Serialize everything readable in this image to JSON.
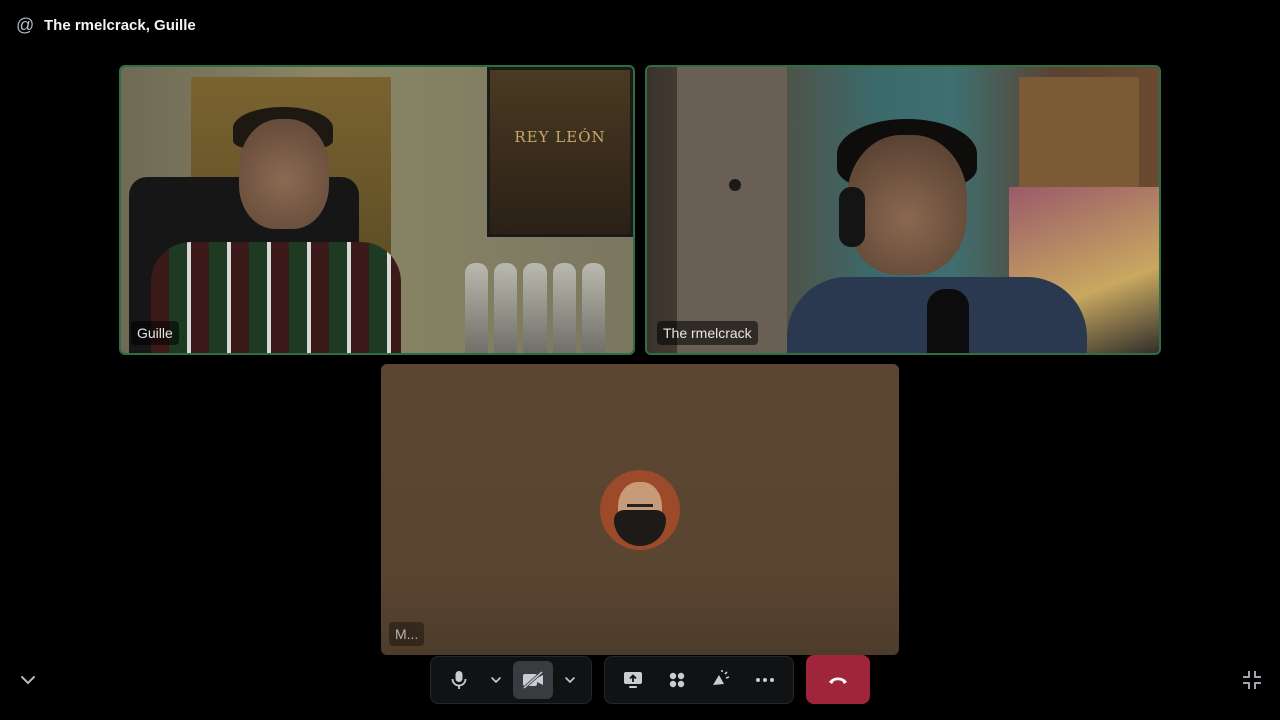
{
  "header": {
    "icon": "at-icon",
    "at_symbol": "@",
    "title": "The rmelcrack, Guille"
  },
  "participants": [
    {
      "name": "Guille",
      "type": "video",
      "speaking": true
    },
    {
      "name": "The rmelcrack",
      "type": "video",
      "speaking": true
    },
    {
      "name": "M...",
      "type": "avatar",
      "speaking": false
    }
  ],
  "video_guille": {
    "poster_text": "REY LEÓN"
  },
  "controls": {
    "mic_icon": "microphone-icon",
    "camera_icon": "camera-off-icon",
    "screen_share_icon": "screen-share-icon",
    "activities_icon": "activities-icon",
    "soundboard_icon": "soundboard-icon",
    "more_icon": "more-icon",
    "hangup_icon": "phone-hangup-icon"
  },
  "colors": {
    "speaking_border": "#2f6e42",
    "hangup": "#a1253a",
    "background": "#000000"
  }
}
